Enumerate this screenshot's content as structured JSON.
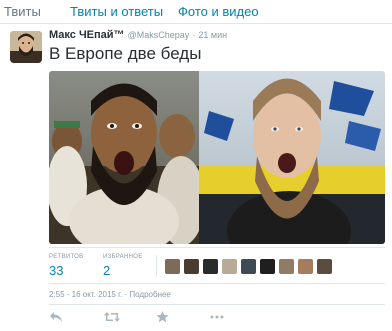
{
  "tabs": [
    {
      "label": "Твиты",
      "active": true
    },
    {
      "label": "Твиты и ответы",
      "active": false
    },
    {
      "label": "Фото и видео",
      "active": false
    }
  ],
  "tweet": {
    "author_name": "Макс ЧЕпай™",
    "handle": "@MaksChepay",
    "separator": "·",
    "time": "21 мин",
    "text": "В Европе две беды",
    "photo_icon": "photo-two-men-shouting"
  },
  "stats": {
    "retweets_label": "РЕТВИТОВ",
    "retweets": "33",
    "favorites_label": "ИЗБРАННОЕ",
    "favorites": "2"
  },
  "avatars_icon": "favoriter-avatars",
  "timestamp": {
    "text": "2:55 - 16 окт. 2015 г.",
    "separator": "·",
    "details_link": "Подробнее"
  },
  "actions": [
    "reply-icon",
    "retweet-icon",
    "favorite-icon",
    "more-icon"
  ],
  "colors": {
    "link": "#0084b4",
    "muted": "#8899a6",
    "text": "#292f33",
    "border": "#e1e8ed"
  }
}
